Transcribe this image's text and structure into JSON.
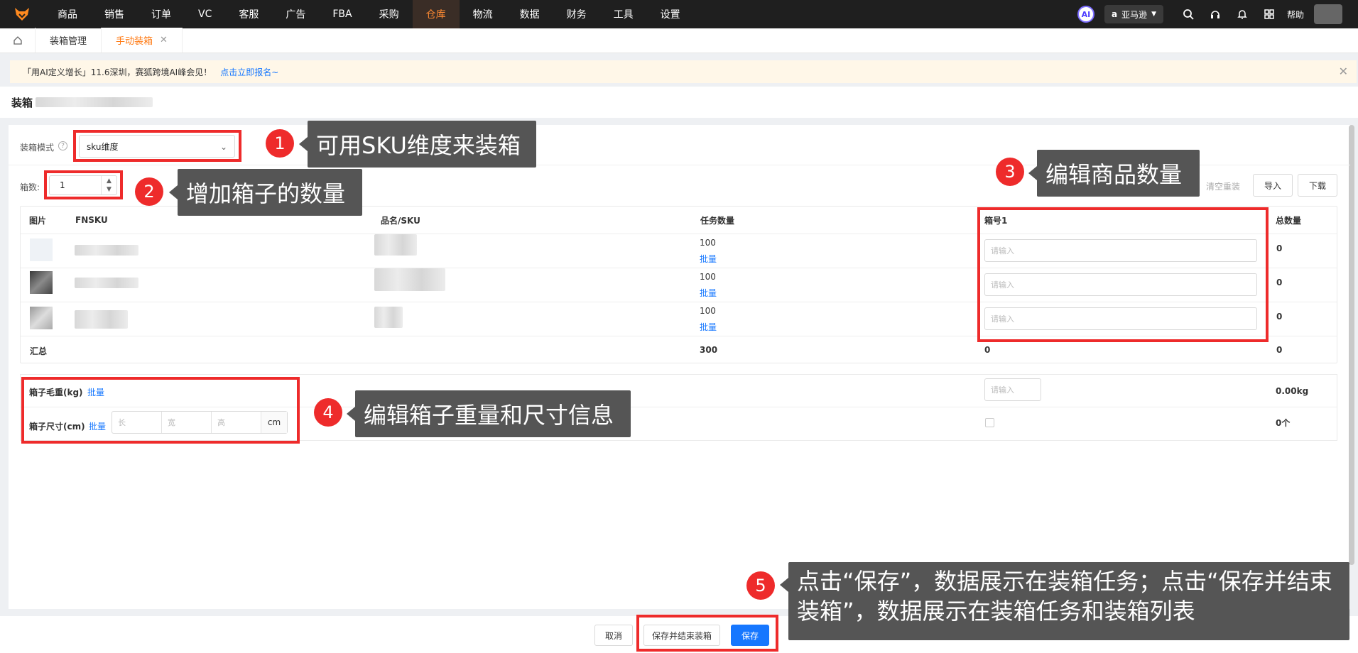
{
  "nav": {
    "items": [
      "商品",
      "销售",
      "订单",
      "VC",
      "客服",
      "广告",
      "FBA",
      "采购",
      "仓库",
      "物流",
      "数据",
      "财务",
      "工具",
      "设置"
    ],
    "active_index": 8,
    "ai_label": "AI",
    "store_label": "亚马逊",
    "help_label": "帮助"
  },
  "tabs": {
    "items": [
      "装箱管理",
      "手动装箱"
    ],
    "active_index": 1
  },
  "notice": {
    "text": "「用AI定义增长」11.6深圳，赛狐跨境AI峰会见！",
    "link": "点击立即报名~"
  },
  "header": {
    "title": "装箱"
  },
  "form": {
    "mode_label": "装箱模式",
    "mode_value": "sku维度",
    "box_count_label": "箱数:",
    "box_count_value": "1",
    "clear_label": "清空重装",
    "import_label": "导入",
    "download_label": "下载"
  },
  "table": {
    "headers": [
      "图片",
      "FNSKU",
      "品名/SKU",
      "任务数量",
      "箱号1",
      "总数量"
    ],
    "rows": [
      {
        "qty": "100",
        "batch": "批量",
        "placeholder": "请输入",
        "total": "0"
      },
      {
        "qty": "100",
        "batch": "批量",
        "placeholder": "请输入",
        "total": "0"
      },
      {
        "qty": "100",
        "batch": "批量",
        "placeholder": "请输入",
        "total": "0"
      }
    ],
    "summary": {
      "label": "汇总",
      "qty": "300",
      "box": "0",
      "total": "0"
    }
  },
  "box_info": {
    "weight_label": "箱子毛重(kg)",
    "weight_batch": "批量",
    "weight_placeholder": "请输入",
    "weight_total": "0.00kg",
    "size_label": "箱子尺寸(cm)",
    "size_batch": "批量",
    "len_placeholder": "长",
    "width_placeholder": "宽",
    "height_placeholder": "高",
    "unit": "cm",
    "size_total": "0个"
  },
  "footer": {
    "cancel": "取消",
    "save_finish": "保存并结束装箱",
    "save": "保存"
  },
  "annotations": {
    "n1": "1",
    "c1": "可用SKU维度来装箱",
    "n2": "2",
    "c2": "增加箱子的数量",
    "n3": "3",
    "c3": "编辑商品数量",
    "n4": "4",
    "c4": "编辑箱子重量和尺寸信息",
    "n5": "5",
    "c5": "点击“保存”，数据展示在装箱任务；点击“保存并结束装箱”，数据展示在装箱任务和装箱列表"
  },
  "colors": {
    "accent": "#ff7a14",
    "primary": "#1677ff",
    "annotation_red": "#ee2b2b",
    "callout_bg": "#555555"
  }
}
